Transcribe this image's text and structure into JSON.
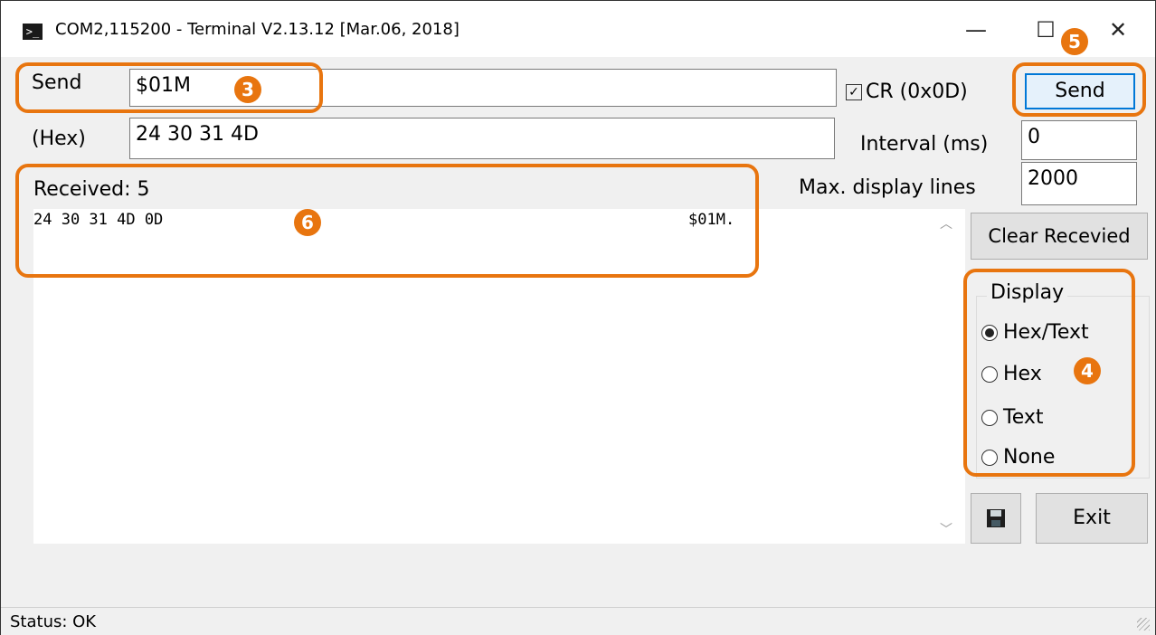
{
  "window": {
    "title": "COM2,115200 - Terminal V2.13.12 [Mar.06, 2018]",
    "icon": "terminal-icon",
    "controls": {
      "minimize": "—",
      "maximize": "☐",
      "close": "✕"
    }
  },
  "send": {
    "label": "Send",
    "value": "$01M",
    "hex_label": "(Hex)",
    "hex_value": "24 30 31 4D",
    "cr_label": "CR (0x0D)",
    "cr_checked": true,
    "button_label": "Send"
  },
  "interval": {
    "label": "Interval (ms)",
    "value": "0"
  },
  "max_lines": {
    "label": "Max. display lines",
    "value": "2000"
  },
  "received": {
    "label": "Received: 5",
    "hex": "24 30 31 4D 0D",
    "ascii": "$01M."
  },
  "buttons": {
    "clear": "Clear Recevied",
    "exit": "Exit",
    "save_icon": "floppy-disk-icon"
  },
  "display": {
    "title": "Display",
    "options": [
      "Hex/Text",
      "Hex",
      "Text",
      "None"
    ],
    "selected": "Hex/Text"
  },
  "status": {
    "text": "Status: OK"
  },
  "annotations": {
    "accent": "#e8750f",
    "badge_send": "3",
    "badge_display": "4",
    "badge_send_button": "5",
    "badge_received": "6"
  }
}
